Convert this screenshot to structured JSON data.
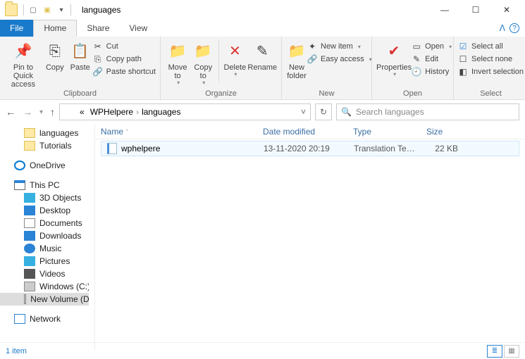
{
  "window": {
    "title": "languages"
  },
  "tabs": {
    "file": "File",
    "home": "Home",
    "share": "Share",
    "view": "View"
  },
  "ribbon": {
    "clipboard": {
      "label": "Clipboard",
      "pin": "Pin to Quick access",
      "copy": "Copy",
      "paste": "Paste",
      "cut": "Cut",
      "copypath": "Copy path",
      "pasteshortcut": "Paste shortcut"
    },
    "organize": {
      "label": "Organize",
      "moveto": "Move to",
      "copyto": "Copy to",
      "delete": "Delete",
      "rename": "Rename"
    },
    "new": {
      "label": "New",
      "newfolder": "New folder",
      "newitem": "New item",
      "easyaccess": "Easy access"
    },
    "open": {
      "label": "Open",
      "properties": "Properties",
      "open": "Open",
      "edit": "Edit",
      "history": "History"
    },
    "select": {
      "label": "Select",
      "selectall": "Select all",
      "selectnone": "Select none",
      "invert": "Invert selection"
    }
  },
  "address": {
    "segments": [
      "«",
      "WPHelpere",
      "languages"
    ],
    "search_placeholder": "Search languages"
  },
  "tree": {
    "items": [
      {
        "label": "languages",
        "icon": "folder",
        "indent": true
      },
      {
        "label": "Tutorials",
        "icon": "folder",
        "indent": true
      },
      {
        "gap": true
      },
      {
        "label": "OneDrive",
        "icon": "onedrive"
      },
      {
        "gap": true
      },
      {
        "label": "This PC",
        "icon": "pc"
      },
      {
        "label": "3D Objects",
        "icon": "obj3d",
        "indent": true
      },
      {
        "label": "Desktop",
        "icon": "desktop",
        "indent": true
      },
      {
        "label": "Documents",
        "icon": "docs",
        "indent": true
      },
      {
        "label": "Downloads",
        "icon": "down",
        "indent": true
      },
      {
        "label": "Music",
        "icon": "music",
        "indent": true
      },
      {
        "label": "Pictures",
        "icon": "pics",
        "indent": true
      },
      {
        "label": "Videos",
        "icon": "vids",
        "indent": true
      },
      {
        "label": "Windows  (C:)",
        "icon": "drive",
        "indent": true
      },
      {
        "label": "New Volume (D:)",
        "icon": "drive",
        "indent": true,
        "selected": true
      },
      {
        "gap": true
      },
      {
        "label": "Network",
        "icon": "net"
      }
    ]
  },
  "cols": {
    "name": "Name",
    "date": "Date modified",
    "type": "Type",
    "size": "Size"
  },
  "files": [
    {
      "name": "wphelpere",
      "date": "13-11-2020 20:19",
      "type": "Translation Templ...",
      "size": "22 KB"
    }
  ],
  "status": {
    "count": "1 item"
  }
}
